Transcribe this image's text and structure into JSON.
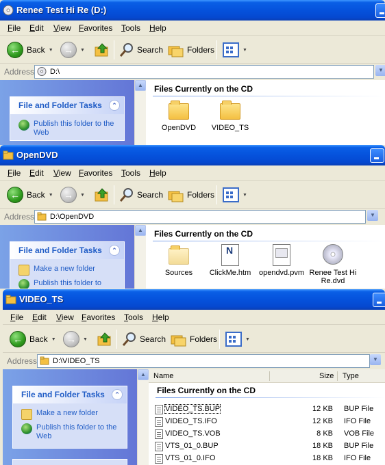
{
  "menu": [
    "File",
    "Edit",
    "View",
    "Favorites",
    "Tools",
    "Help"
  ],
  "toolbar": {
    "back": "Back",
    "search": "Search",
    "folders": "Folders"
  },
  "address_label": "Address",
  "colors": {
    "titlebar": "#0552dc",
    "task_link": "#215dc6",
    "left_pane": "#6f8edf"
  },
  "windows": [
    {
      "title": "Renee Test Hi Re (D:)",
      "address": "D:\\",
      "tasks_header": "File and Folder Tasks",
      "tasks": [
        "Publish this folder to the Web"
      ],
      "group": "Files Currently on the CD",
      "items": [
        {
          "name": "OpenDVD",
          "icon": "folder-icon"
        },
        {
          "name": "VIDEO_TS",
          "icon": "folder-icon"
        }
      ]
    },
    {
      "title": "OpenDVD",
      "address": "D:\\OpenDVD",
      "tasks_header": "File and Folder Tasks",
      "tasks": [
        "Make a new folder",
        "Publish this folder to"
      ],
      "group": "Files Currently on the CD",
      "items": [
        {
          "name": "Sources",
          "icon": "folder-icon"
        },
        {
          "name": "ClickMe.htm",
          "icon": "html-file-icon"
        },
        {
          "name": "opendvd.pvm",
          "icon": "pvm-file-icon"
        },
        {
          "name": "Renee Test Hi Re.dvd",
          "icon": "dvd-disc-icon"
        }
      ]
    },
    {
      "title": "VIDEO_TS",
      "address": "D:\\VIDEO_TS",
      "tasks_header": "File and Folder Tasks",
      "tasks": [
        "Make a new folder",
        "Publish this folder to the Web"
      ],
      "columns": {
        "name": "Name",
        "size": "Size",
        "type": "Type"
      },
      "group": "Files Currently on the CD",
      "files": [
        {
          "name": "VIDEO_TS.BUP",
          "size": "12 KB",
          "type": "BUP File"
        },
        {
          "name": "VIDEO_TS.IFO",
          "size": "12 KB",
          "type": "IFO File"
        },
        {
          "name": "VIDEO_TS.VOB",
          "size": "8 KB",
          "type": "VOB File"
        },
        {
          "name": "VTS_01_0.BUP",
          "size": "18 KB",
          "type": "BUP File"
        },
        {
          "name": "VTS_01_0.IFO",
          "size": "18 KB",
          "type": "IFO File"
        }
      ]
    }
  ]
}
